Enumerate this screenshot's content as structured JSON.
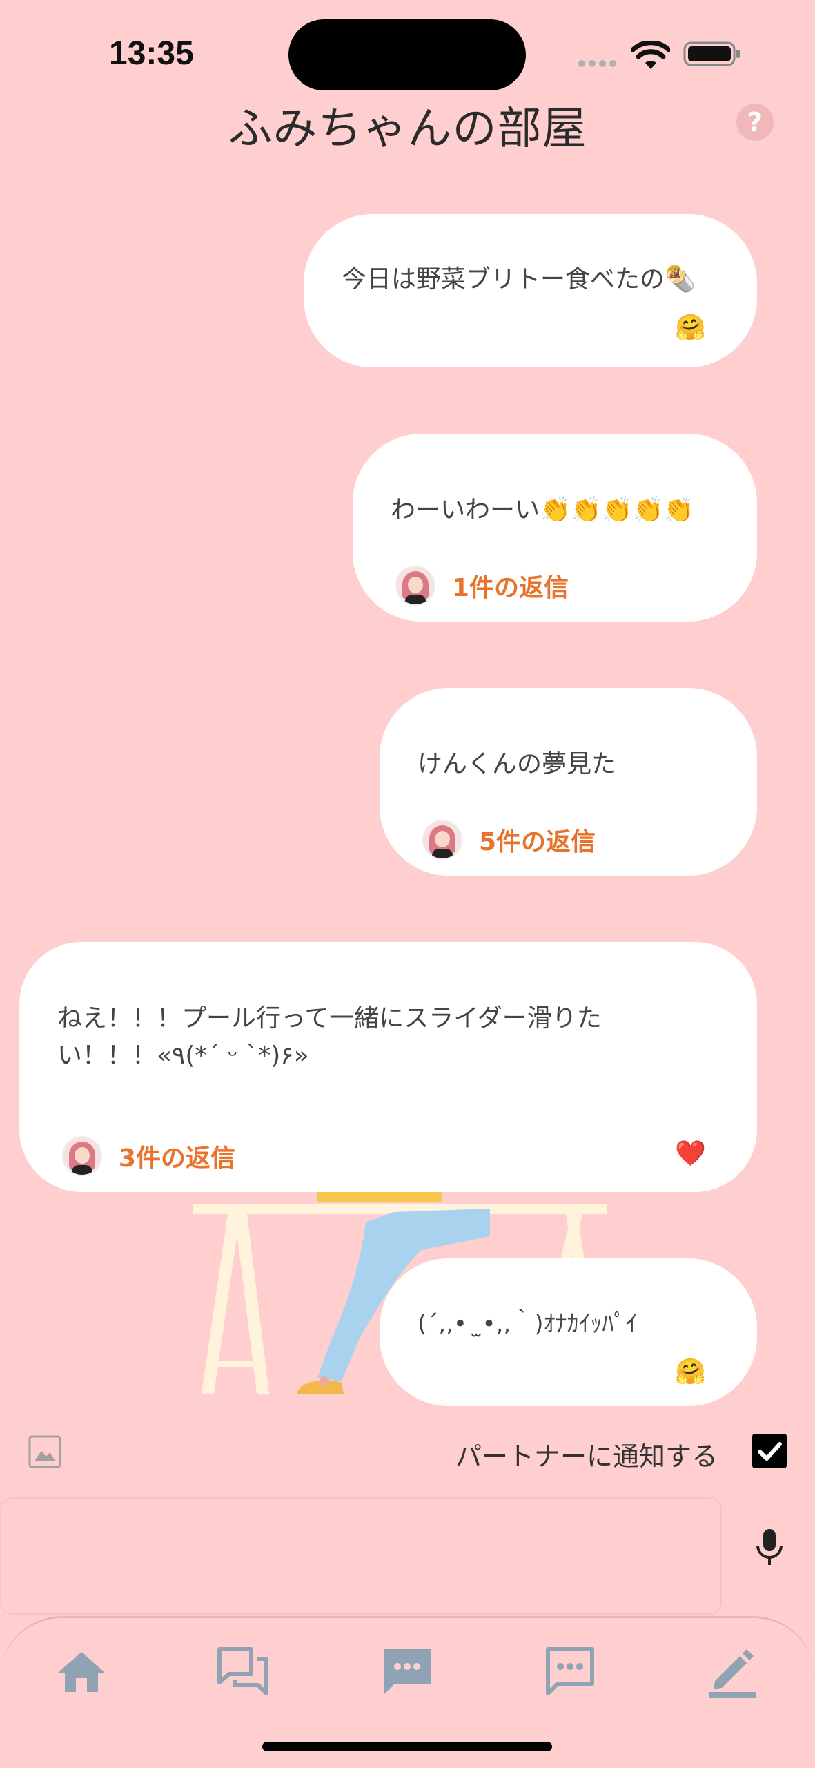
{
  "status_bar": {
    "time": "13:35"
  },
  "header": {
    "title": "ふみちゃんの部屋",
    "help_label": "?"
  },
  "messages": [
    {
      "text": "今日は野菜ブリトー食べたの🌯",
      "reaction": "🤗"
    },
    {
      "text": "わーいわーい👏👏👏👏👏",
      "replies": "1件の返信"
    },
    {
      "text": "けんくんの夢見た",
      "replies": "5件の返信"
    },
    {
      "text": "ねえ！！！プール行って一緒にスライダー滑りた\nい！！！«٩(*´ ᵕ `*)۶»",
      "replies": "3件の返信",
      "reaction": "❤️"
    },
    {
      "text": "(´,,•  ̫•,,｀)ｵﾅｶｲｯﾊﾟｲ",
      "reaction": "🤗"
    }
  ],
  "composer": {
    "notify_label": "パートナーに通知する",
    "notify_checked": true,
    "input_value": "",
    "input_placeholder": ""
  },
  "icons": {
    "image": "image-icon",
    "mic": "microphone-icon",
    "tabs": [
      "home-icon",
      "forum-icon",
      "chat-icon",
      "chat-outline-icon",
      "edit-icon"
    ]
  },
  "colors": {
    "background": "#FFCFCF",
    "reply_accent": "#E8732A",
    "tab_icon": "#8FA3B4"
  }
}
